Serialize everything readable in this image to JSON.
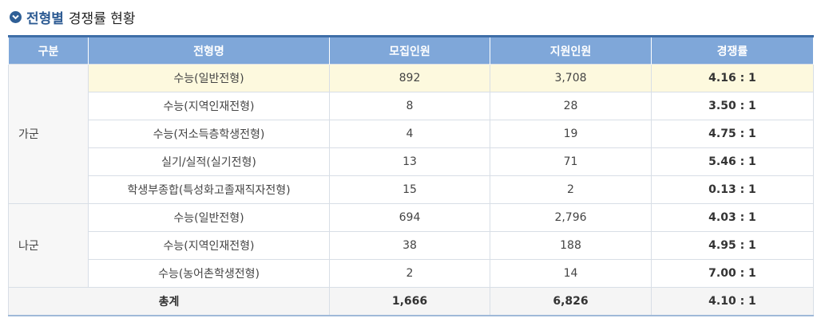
{
  "title": {
    "strong": "전형별",
    "rest": "경쟁률 현황",
    "icon": "chevron-down-circle-icon",
    "accent": "#2d5b93"
  },
  "headers": [
    "구분",
    "전형명",
    "모집인원",
    "지원인원",
    "경쟁률"
  ],
  "groups": [
    {
      "label": "가군",
      "rows": [
        {
          "name": "수능(일반전형)",
          "quota": "892",
          "applicants": "3,708",
          "ratio": "4.16 : 1"
        },
        {
          "name": "수능(지역인재전형)",
          "quota": "8",
          "applicants": "28",
          "ratio": "3.50 : 1"
        },
        {
          "name": "수능(저소득층학생전형)",
          "quota": "4",
          "applicants": "19",
          "ratio": "4.75 : 1"
        },
        {
          "name": "실기/실적(실기전형)",
          "quota": "13",
          "applicants": "71",
          "ratio": "5.46 : 1"
        },
        {
          "name": "학생부종합(특성화고졸재직자전형)",
          "quota": "15",
          "applicants": "2",
          "ratio": "0.13 : 1"
        }
      ]
    },
    {
      "label": "나군",
      "rows": [
        {
          "name": "수능(일반전형)",
          "quota": "694",
          "applicants": "2,796",
          "ratio": "4.03 : 1"
        },
        {
          "name": "수능(지역인재전형)",
          "quota": "38",
          "applicants": "188",
          "ratio": "4.95 : 1"
        },
        {
          "name": "수능(농어촌학생전형)",
          "quota": "2",
          "applicants": "14",
          "ratio": "7.00 : 1"
        }
      ]
    }
  ],
  "total": {
    "label": "총계",
    "quota": "1,666",
    "applicants": "6,826",
    "ratio": "4.10 : 1"
  },
  "colors": {
    "header_bg": "#7fa7d9",
    "header_border_top": "#3f6ea7",
    "highlight_row": "#fdf9de",
    "group_bg": "#f7f7f7"
  }
}
